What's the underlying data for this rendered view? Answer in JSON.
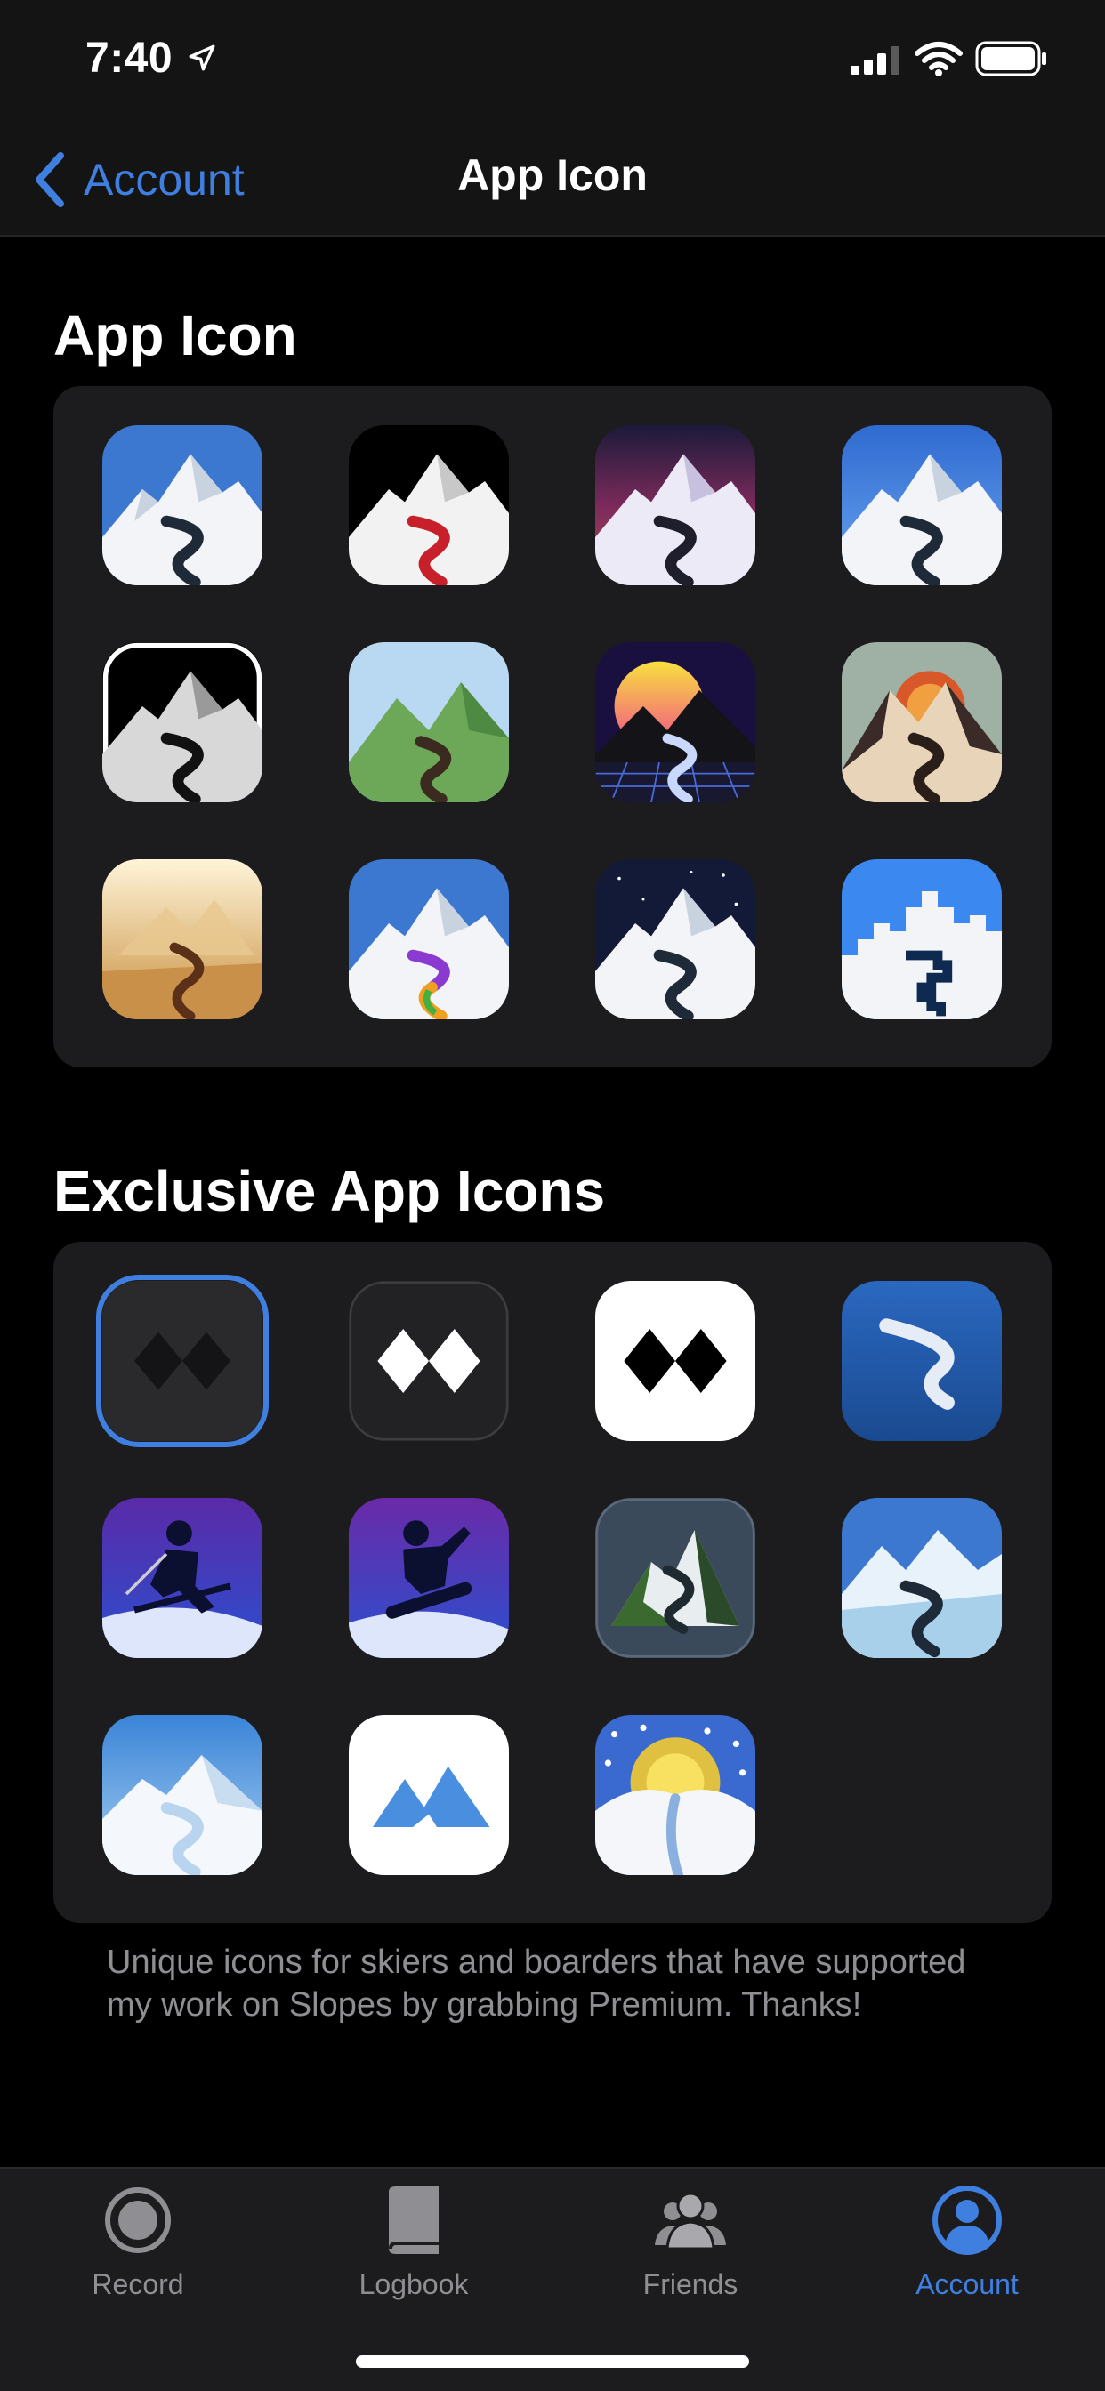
{
  "status": {
    "time": "7:40"
  },
  "nav": {
    "back_label": "Account",
    "title": "App Icon"
  },
  "sections": {
    "app_icons_title": "App Icon",
    "exclusive_title": "Exclusive App Icons",
    "exclusive_footnote": "Unique icons for skiers and boarders that have supported my work on Slopes by grabbing Premium. Thanks!"
  },
  "app_icons": [
    "classic-blue-icon",
    "night-red-icon",
    "dusk-purple-icon",
    "gradient-blue-icon",
    "monochrome-icon",
    "green-hills-icon",
    "retro-synthwave-icon",
    "sunset-beige-icon",
    "desert-gold-icon",
    "pride-rainbow-icon",
    "starry-night-icon",
    "pixel-blue-icon"
  ],
  "exclusive_icons": [
    "dark-diamonds-icon",
    "gray-diamonds-icon",
    "white-diamonds-icon",
    "blue-s-icon",
    "skier-purple-icon",
    "snowboarder-purple-icon",
    "realistic-mountain-icon",
    "blue-ice-icon",
    "soft-blue-icon",
    "minimal-peaks-icon",
    "snowy-sun-icon"
  ],
  "selected_exclusive_index": 0,
  "tabs": [
    {
      "label": "Record",
      "icon": "record-icon",
      "active": false
    },
    {
      "label": "Logbook",
      "icon": "book-icon",
      "active": false
    },
    {
      "label": "Friends",
      "icon": "friends-icon",
      "active": false
    },
    {
      "label": "Account",
      "icon": "account-icon",
      "active": true
    }
  ],
  "colors": {
    "accent": "#3e7fe0",
    "card": "#1c1c1e",
    "background": "#000000",
    "secondary_text": "#8e8e93"
  }
}
